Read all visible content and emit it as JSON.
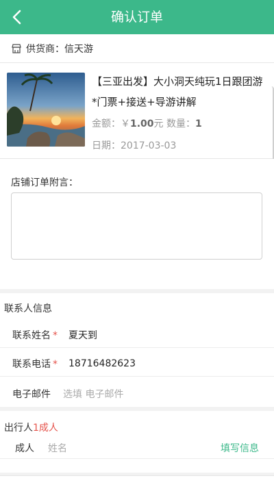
{
  "header": {
    "title": "确认订单",
    "back_icon": "chevron-left-icon"
  },
  "supplier": {
    "icon": "store-icon",
    "text": "供货商：信天游"
  },
  "product": {
    "title": "【三亚出发】大小洞天纯玩1日跟团游*门票+接送+导游讲解",
    "price_label": "金额：￥",
    "price": "1.00",
    "price_unit": "元",
    "qty_label": "数量：",
    "qty": "1",
    "date_label": "日期：",
    "date": "2017-03-03"
  },
  "remark": {
    "label": "店铺订单附言：",
    "value": ""
  },
  "contact": {
    "section_title": "联系人信息",
    "name_label": "联系姓名",
    "name_value": "夏天到",
    "phone_label": "联系电话",
    "phone_value": "18716482623",
    "email_label": "电子邮件",
    "email_placeholder": "选填 电子邮件",
    "required_mark": "*"
  },
  "travelers": {
    "section_title": "出行人",
    "count_text": "1成人",
    "row_label": "成人",
    "name_placeholder": "姓名",
    "fill_link": "填写信息"
  },
  "colors": {
    "accent": "#3cb88a",
    "required": "#e5534b"
  }
}
